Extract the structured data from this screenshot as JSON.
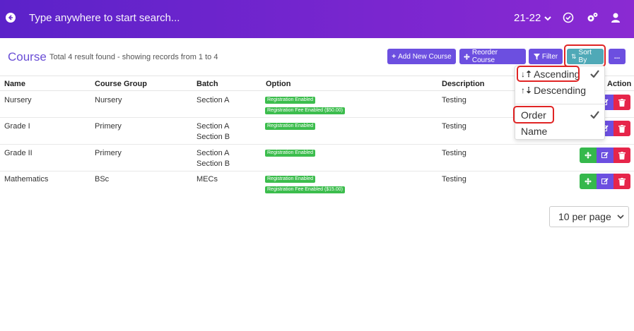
{
  "header": {
    "search_placeholder": "Type anywhere to start search...",
    "year": "21-22",
    "icons": [
      "back-icon",
      "check-circle-icon",
      "settings-icon",
      "user-icon"
    ],
    "gradient": [
      "#5b22c9",
      "#8a2ad2"
    ]
  },
  "page": {
    "title": "Course",
    "result_text": "Total 4 result found - showing records from 1 to 4"
  },
  "toolbar": {
    "add_label": "Add New Course",
    "reorder_label": "Reorder Course",
    "filter_label": "Filter",
    "sort_label": "Sort By",
    "more_label": "..."
  },
  "table": {
    "columns": [
      "Name",
      "Course Group",
      "Batch",
      "Option",
      "Description",
      "Action"
    ],
    "rows": [
      {
        "name": "Nursery",
        "group": "Nursery",
        "batch1": "Section A",
        "batch2": "",
        "badge1": "Registration Enabled",
        "badge2": "Registration Fee Enabled ($50.00)",
        "description": "Testing"
      },
      {
        "name": "Grade I",
        "group": "Primery",
        "batch1": "Section A",
        "batch2": "Section B",
        "badge1": "Registration Enabled",
        "badge2": "",
        "description": "Testing"
      },
      {
        "name": "Grade II",
        "group": "Primery",
        "batch1": "Section A",
        "batch2": "Section B",
        "badge1": "Registration Enabled",
        "badge2": "",
        "description": "Testing"
      },
      {
        "name": "Mathematics",
        "group": "BSc",
        "batch1": "MECs",
        "batch2": "",
        "badge1": "Registration Enabled",
        "badge2": "Registration Fee Enabled ($15.00)",
        "description": "Testing"
      }
    ]
  },
  "sort_menu": {
    "ascending": "Ascending",
    "descending": "Descending",
    "order": "Order",
    "name": "Name",
    "selected_direction": "Ascending",
    "selected_field": "Order"
  },
  "pagination": {
    "per_page": "10 per page"
  },
  "colors": {
    "primary": "#6c4fe0",
    "sort_button": "#4fa9b7",
    "badge": "#3cbd4d",
    "danger": "#e6254a",
    "success": "#35b84c",
    "highlight": "#e02424"
  }
}
